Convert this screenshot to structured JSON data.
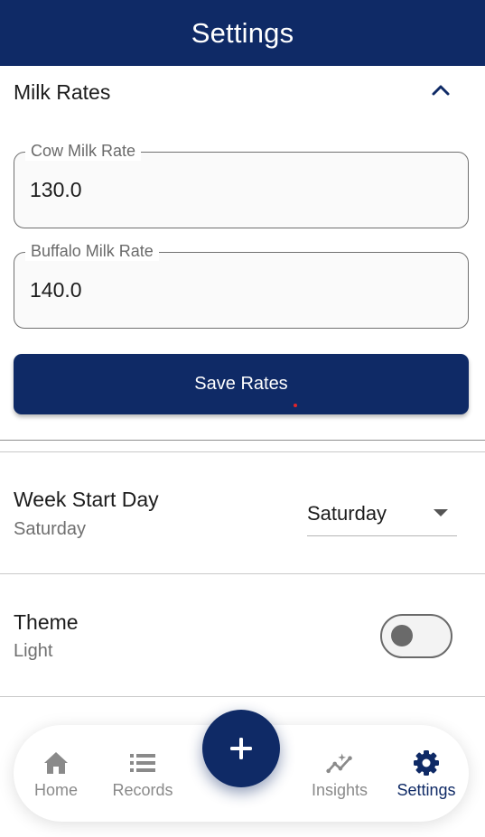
{
  "header": {
    "title": "Settings"
  },
  "milk_rates": {
    "section_title": "Milk Rates",
    "cow": {
      "label": "Cow Milk Rate",
      "value": "130.0"
    },
    "buffalo": {
      "label": "Buffalo Milk Rate",
      "value": "140.0"
    },
    "save_label": "Save Rates"
  },
  "week_start": {
    "title": "Week Start Day",
    "subtitle": "Saturday",
    "selected": "Saturday"
  },
  "theme": {
    "title": "Theme",
    "subtitle": "Light",
    "dark_mode_on": false
  },
  "nav": {
    "items": [
      {
        "label": "Home",
        "icon": "home-icon"
      },
      {
        "label": "Records",
        "icon": "list-icon"
      },
      {
        "label": "Insights",
        "icon": "insights-icon"
      },
      {
        "label": "Settings",
        "icon": "gear-icon"
      }
    ],
    "active": "Settings",
    "fab_icon": "plus-icon"
  },
  "colors": {
    "primary": "#0f2a66",
    "inactive": "#8a8a8a",
    "text": "#1c1c1c"
  }
}
